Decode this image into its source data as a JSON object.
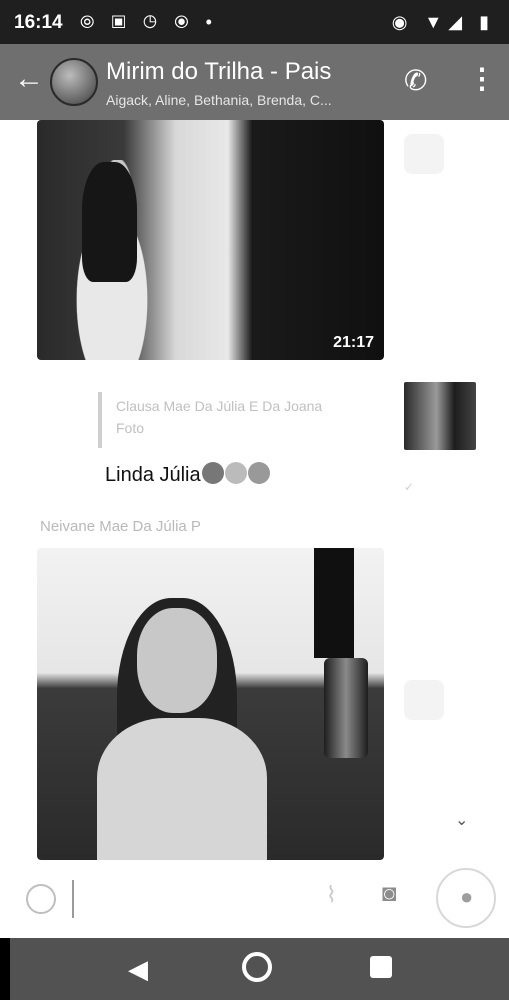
{
  "status_bar": {
    "time": "16:14",
    "left_icons": "⦾ ▣ ◷ ⦿ •",
    "right_icons": "◉ ▼◢ ▮"
  },
  "app_bar": {
    "title": "Mirim do Trilha - Pais",
    "subtitle": "Aigack, Aline, Bethania, Brenda, C..."
  },
  "messages": {
    "photo_1_time": "21:17",
    "reply_author": "Clausa Mae Da Júlia E Da Joana",
    "reply_label": "Foto",
    "text": "Linda Júlia",
    "sender_name": "Neivane Mae Da Júlia P"
  },
  "composer": {
    "placeholder": ""
  },
  "icons": {
    "back": "arrow-left",
    "call": "add-call",
    "menu": "vertical-dots",
    "emoji": "smiley",
    "attach": "paperclip",
    "camera": "camera",
    "mic": "microphone",
    "scroll_down": "double-chevron-down"
  }
}
